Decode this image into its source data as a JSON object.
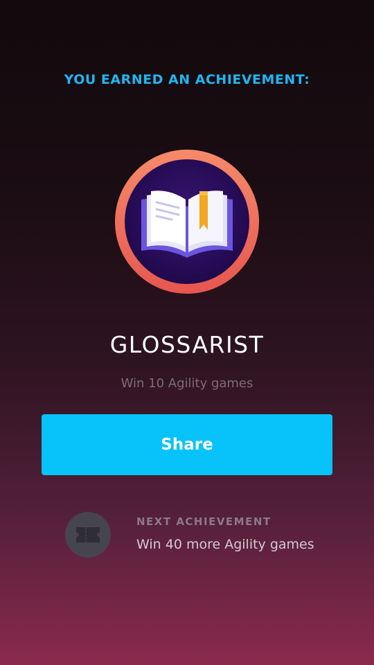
{
  "header": {
    "text": "YOU EARNED AN ACHIEVEMENT:"
  },
  "achievement": {
    "badge_icon": "open-book-icon",
    "title": "GLOSSARIST",
    "description": "Win 10 Agility games"
  },
  "share_button": {
    "label": "Share"
  },
  "next_achievement": {
    "icon": "ticket-icon",
    "label": "NEXT ACHIEVEMENT",
    "description": "Win 40 more Agility games"
  },
  "colors": {
    "accent_blue": "#07c3f9",
    "header_blue": "#1fb6f2",
    "badge_ring": "#f07a5f",
    "badge_center": "#2a0d5e"
  }
}
